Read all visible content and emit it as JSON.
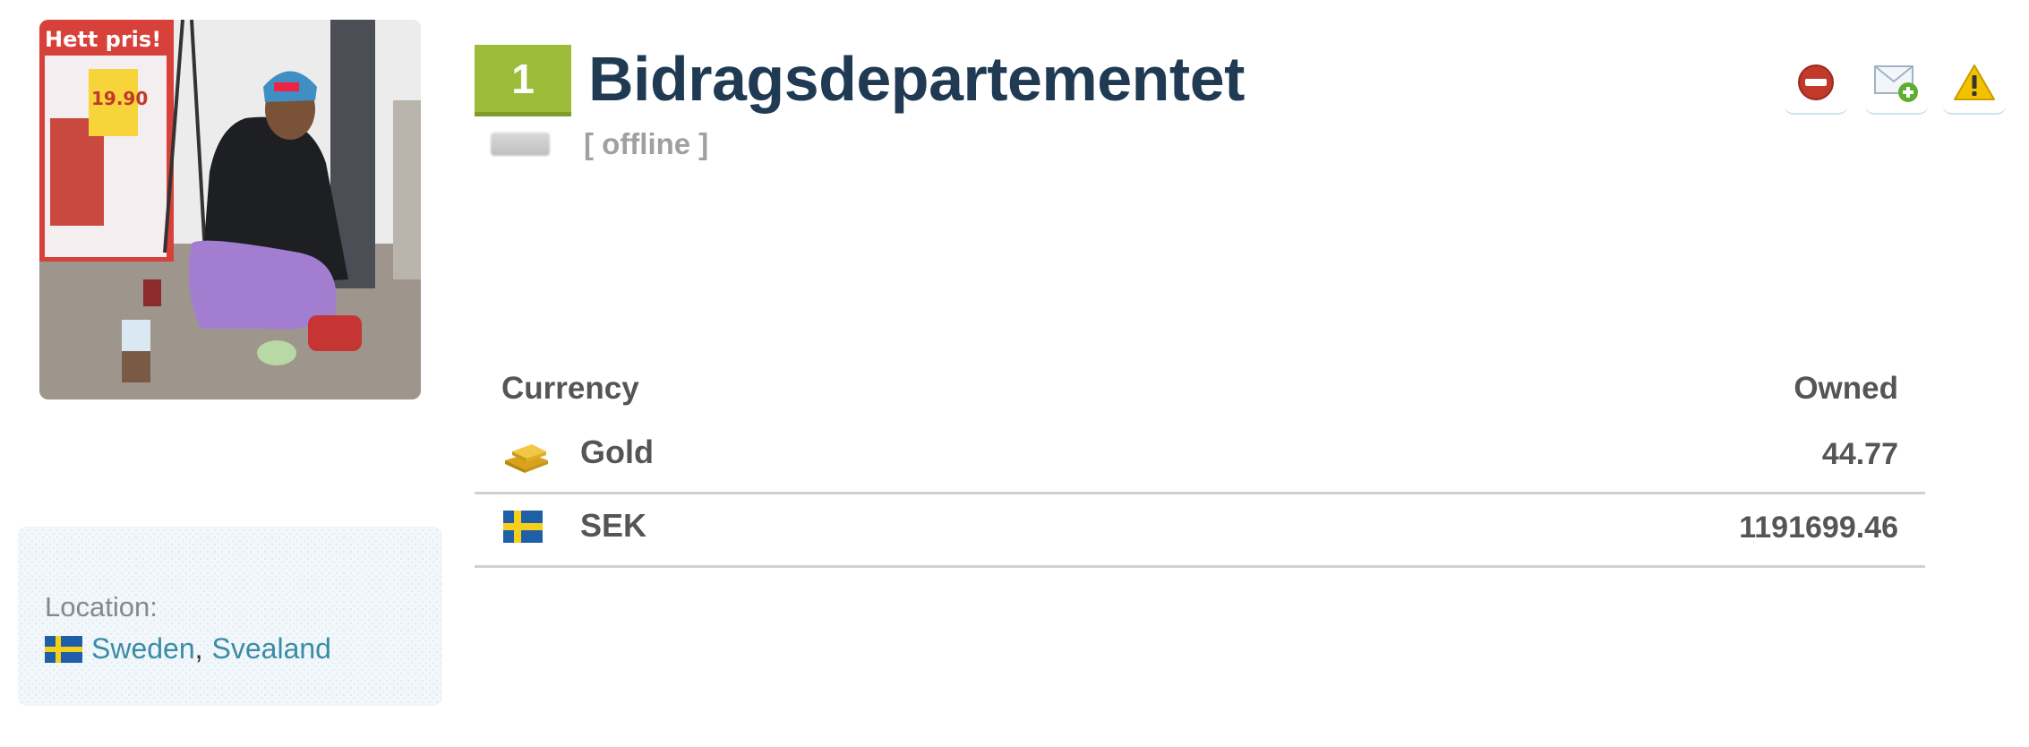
{
  "profile": {
    "rank": "1",
    "name": "Bidragsdepartementet",
    "status": "[ offline ]",
    "avatar_sign_text": "Hett pris!",
    "avatar_price_tag": "19.90"
  },
  "actions": [
    {
      "icon": "block-icon",
      "color": "#c0392b"
    },
    {
      "icon": "add-message-icon",
      "color": "#5fae2e"
    },
    {
      "icon": "warning-icon",
      "color": "#e8b400"
    }
  ],
  "location": {
    "label": "Location:",
    "country": "Sweden",
    "separator": ",",
    "region": "Svealand",
    "flag": "sweden-flag-icon"
  },
  "currencies": {
    "header_currency": "Currency",
    "header_owned": "Owned",
    "rows": [
      {
        "name": "Gold",
        "owned": "44.77",
        "icon": "gold-bars-icon"
      },
      {
        "name": "SEK",
        "owned": "1191699.46",
        "icon": "sweden-flag-icon"
      }
    ]
  },
  "colors": {
    "rank_badge": "#9cbc3a",
    "title": "#1f3a52",
    "link": "#3a8ca6",
    "status": "#a0a0a0"
  }
}
